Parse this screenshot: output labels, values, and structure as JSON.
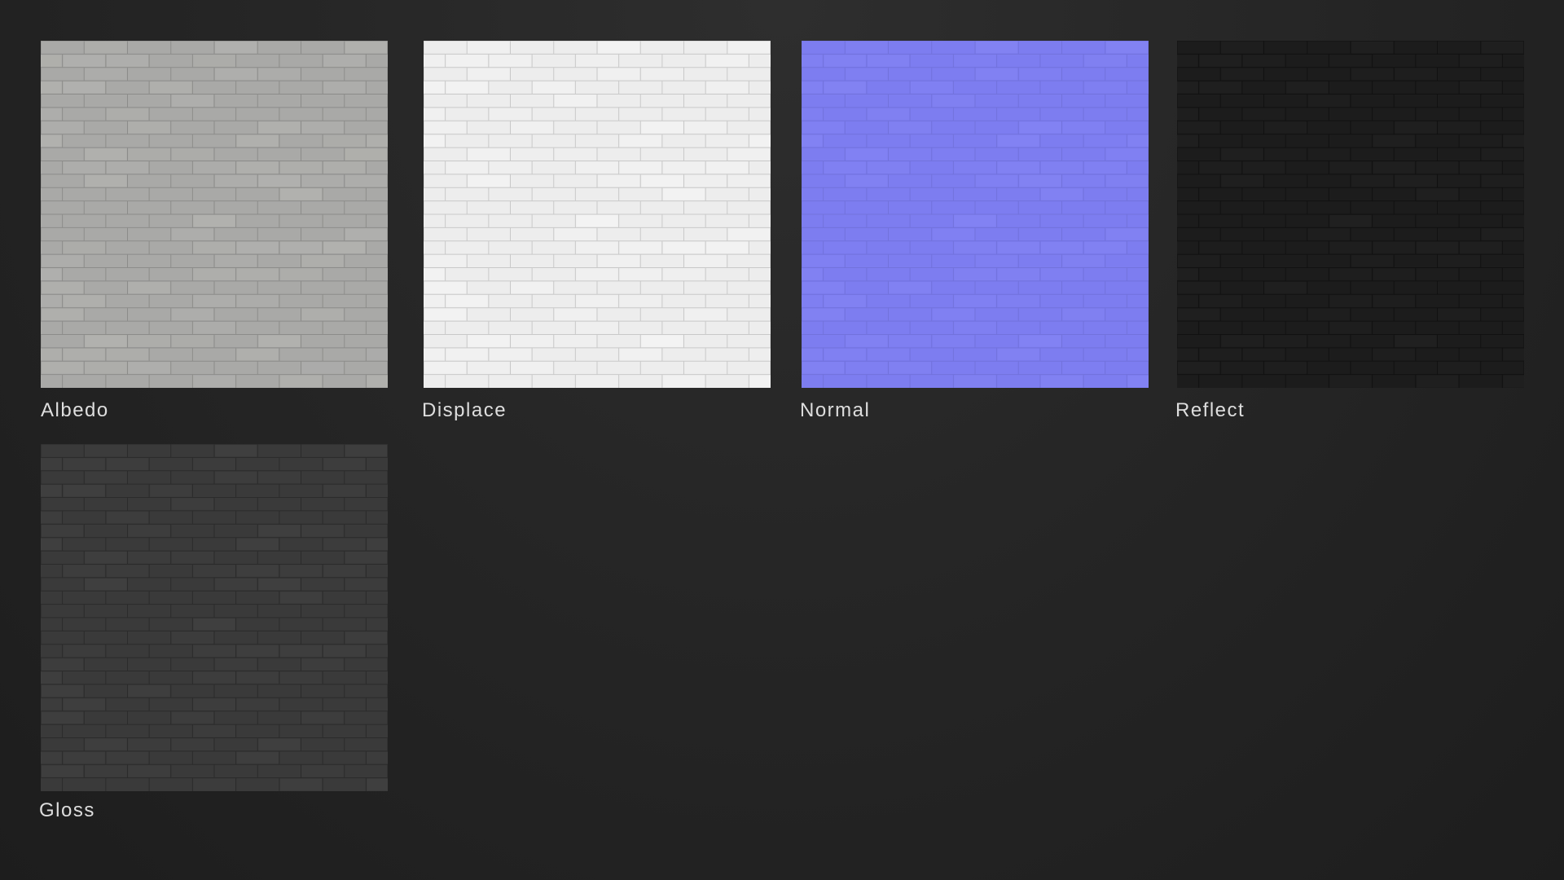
{
  "maps": [
    {
      "label": "Albedo",
      "base_color": "#a9a9a7",
      "line_color": "#8c8c8a",
      "tint": "#b5b5b2"
    },
    {
      "label": "Displace",
      "base_color": "#ededed",
      "line_color": "#c9c9c9",
      "tint": "#f5f5f5"
    },
    {
      "label": "Normal",
      "base_color": "#7d7df0",
      "line_color": "#7272dc",
      "tint": "#8585f4"
    },
    {
      "label": "Reflect",
      "base_color": "#1c1c1c",
      "line_color": "#111111",
      "tint": "#222222"
    },
    {
      "label": "Gloss",
      "base_color": "#3a3a3a",
      "line_color": "#2b2b2b",
      "tint": "#424242"
    }
  ],
  "background_color": "#232323",
  "label_color": "#dedede"
}
